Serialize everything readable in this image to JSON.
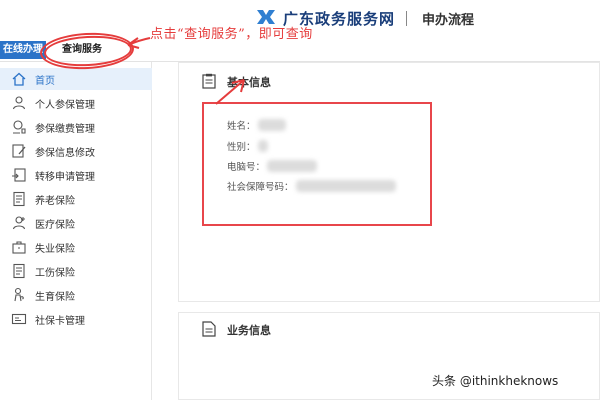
{
  "header": {
    "site_title": "广东政务服务网",
    "process_title": "申办流程",
    "brand_color": "#1a3e7a"
  },
  "tabs": {
    "online": "在线办理",
    "query": "查询服务"
  },
  "sidebar": {
    "accent": "#2b73c8",
    "items": [
      {
        "label": "首页",
        "icon": "home-icon",
        "active": true
      },
      {
        "label": "个人参保管理",
        "icon": "person-icon"
      },
      {
        "label": "参保缴费管理",
        "icon": "payment-icon"
      },
      {
        "label": "参保信息修改",
        "icon": "edit-icon"
      },
      {
        "label": "转移申请管理",
        "icon": "transfer-icon"
      },
      {
        "label": "养老保险",
        "icon": "document-icon"
      },
      {
        "label": "医疗保险",
        "icon": "medical-person-icon"
      },
      {
        "label": "失业保险",
        "icon": "briefcase-icon"
      },
      {
        "label": "工伤保险",
        "icon": "document-icon"
      },
      {
        "label": "生育保险",
        "icon": "maternity-icon"
      },
      {
        "label": "社保卡管理",
        "icon": "card-icon"
      }
    ]
  },
  "basic_info": {
    "title": "基本信息",
    "fields": [
      {
        "label": "姓名："
      },
      {
        "label": "性别："
      },
      {
        "label": "电脑号："
      },
      {
        "label": "社会保障号码："
      }
    ]
  },
  "business_info": {
    "title": "业务信息"
  },
  "annotation": {
    "text": "点击“查询服务”，即可查询",
    "color": "#e53c3c"
  },
  "watermark": "头条 @ithinkheknows"
}
